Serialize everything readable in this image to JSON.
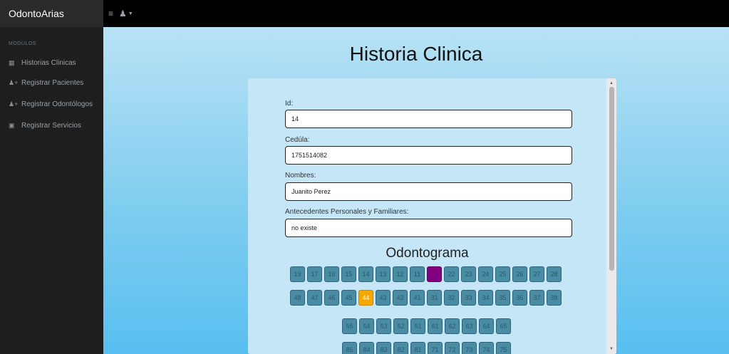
{
  "app": {
    "brand": "OdontoArias"
  },
  "sidebar": {
    "section_label": "MODULOS",
    "items": [
      {
        "label": "Historias Clinicas",
        "icon": "calendar-icon"
      },
      {
        "label": "Registrar Pacientes",
        "icon": "user-add-icon"
      },
      {
        "label": "Registrar Odontólogos",
        "icon": "user-add-icon"
      },
      {
        "label": "Registrar Servicios",
        "icon": "clipboard-icon"
      }
    ]
  },
  "page": {
    "title": "Historia Clinica"
  },
  "form": {
    "id": {
      "label": "Id:",
      "value": "14"
    },
    "cedula": {
      "label": "Cedúla:",
      "value": "1751514082"
    },
    "nombres": {
      "label": "Nombres:",
      "value": "Juanito Perez"
    },
    "antecedentes": {
      "label": "Antecedentes Personales y Familiares:",
      "value": "no existe"
    }
  },
  "odontograma": {
    "title": "Odontograma",
    "rows": [
      [
        "19",
        "17",
        "16",
        "15",
        "14",
        "13",
        "12",
        "11",
        "21",
        "22",
        "23",
        "24",
        "25",
        "26",
        "27",
        "28"
      ],
      [
        "48",
        "47",
        "46",
        "45",
        "44",
        "43",
        "42",
        "41",
        "31",
        "32",
        "33",
        "34",
        "35",
        "36",
        "37",
        "38"
      ],
      [
        "55",
        "54",
        "53",
        "52",
        "51",
        "61",
        "62",
        "63",
        "64",
        "65"
      ],
      [
        "85",
        "84",
        "83",
        "82",
        "81",
        "71",
        "72",
        "73",
        "74",
        "75"
      ]
    ],
    "selected": {
      "21": "purple",
      "44": "orange"
    },
    "colors": {
      "tooth": "#4a8ca3",
      "purple": "#800080",
      "orange": "#f7a800"
    }
  }
}
